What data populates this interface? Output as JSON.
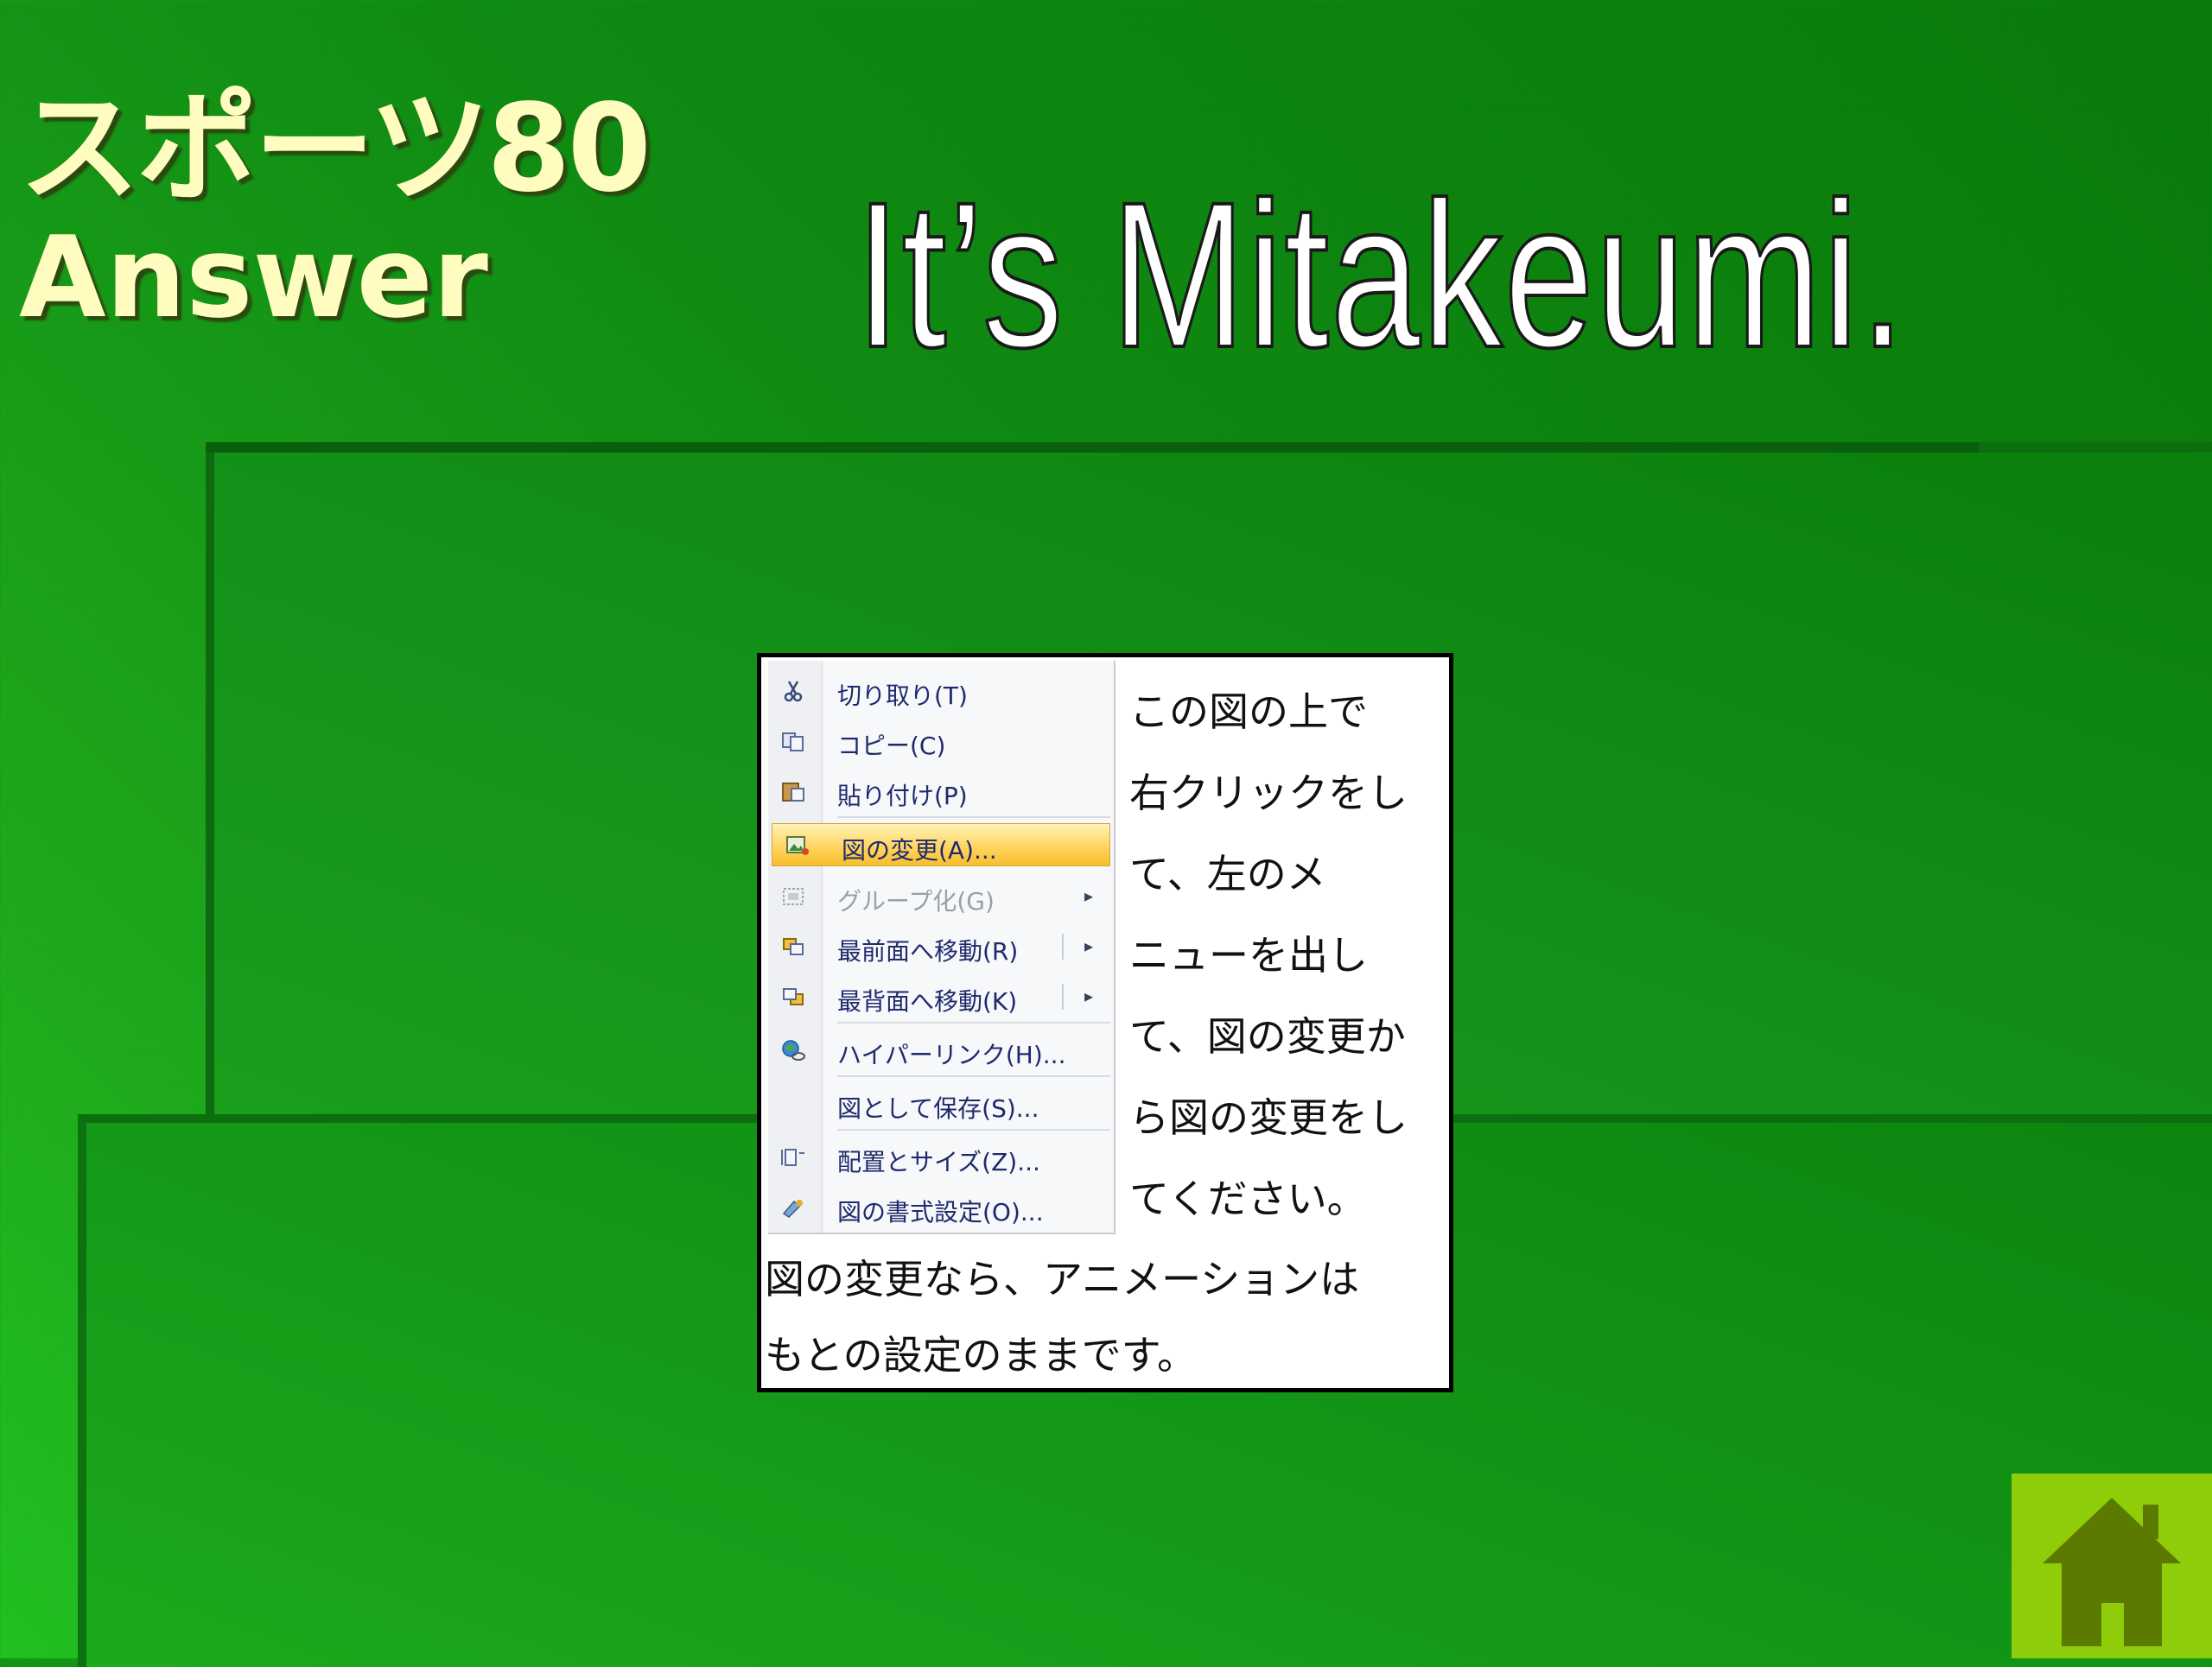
{
  "slide": {
    "title_line1": "スポーツ80",
    "title_line2": "Answer",
    "headline": "It’s Mitakeumi."
  },
  "picture_placeholder": {
    "context_menu": {
      "items": [
        {
          "label": "切り取り(T)",
          "icon": "scissors-icon",
          "state": "normal"
        },
        {
          "label": "コピー(C)",
          "icon": "copy-icon",
          "state": "normal"
        },
        {
          "label": "貼り付け(P)",
          "icon": "paste-icon",
          "state": "normal"
        },
        {
          "label": "図の変更(A)...",
          "icon": "change-picture-icon",
          "state": "highlighted"
        },
        {
          "label": "グループ化(G)",
          "icon": "group-icon",
          "state": "disabled",
          "submenu": true
        },
        {
          "label": "最前面へ移動(R)",
          "icon": "bring-to-front-icon",
          "state": "normal",
          "submenu": true
        },
        {
          "label": "最背面へ移動(K)",
          "icon": "send-to-back-icon",
          "state": "normal",
          "submenu": true
        },
        {
          "label": "ハイパーリンク(H)...",
          "icon": "hyperlink-icon",
          "state": "normal"
        },
        {
          "label": "図として保存(S)...",
          "icon": "",
          "state": "normal"
        },
        {
          "label": "配置とサイズ(Z)...",
          "icon": "size-position-icon",
          "state": "normal"
        },
        {
          "label": "図の書式設定(O)...",
          "icon": "format-picture-icon",
          "state": "normal"
        }
      ]
    },
    "instruction_lines": [
      "この図の上で",
      "右クリックをし",
      "て、左のメ",
      "ニューを出し",
      "て、図の変更か",
      "ら図の変更をし",
      "てください。"
    ],
    "note_lines": [
      "図の変更なら、アニメーションは",
      "もとの設定のままです。"
    ]
  },
  "home_button": {
    "icon": "home-icon"
  },
  "colors": {
    "background": "#0f8a12",
    "title_text": "#fffcc0",
    "home_button": "#8fcc0a",
    "home_icon": "#5a7a00",
    "menu_highlight": "#ffd25a"
  }
}
